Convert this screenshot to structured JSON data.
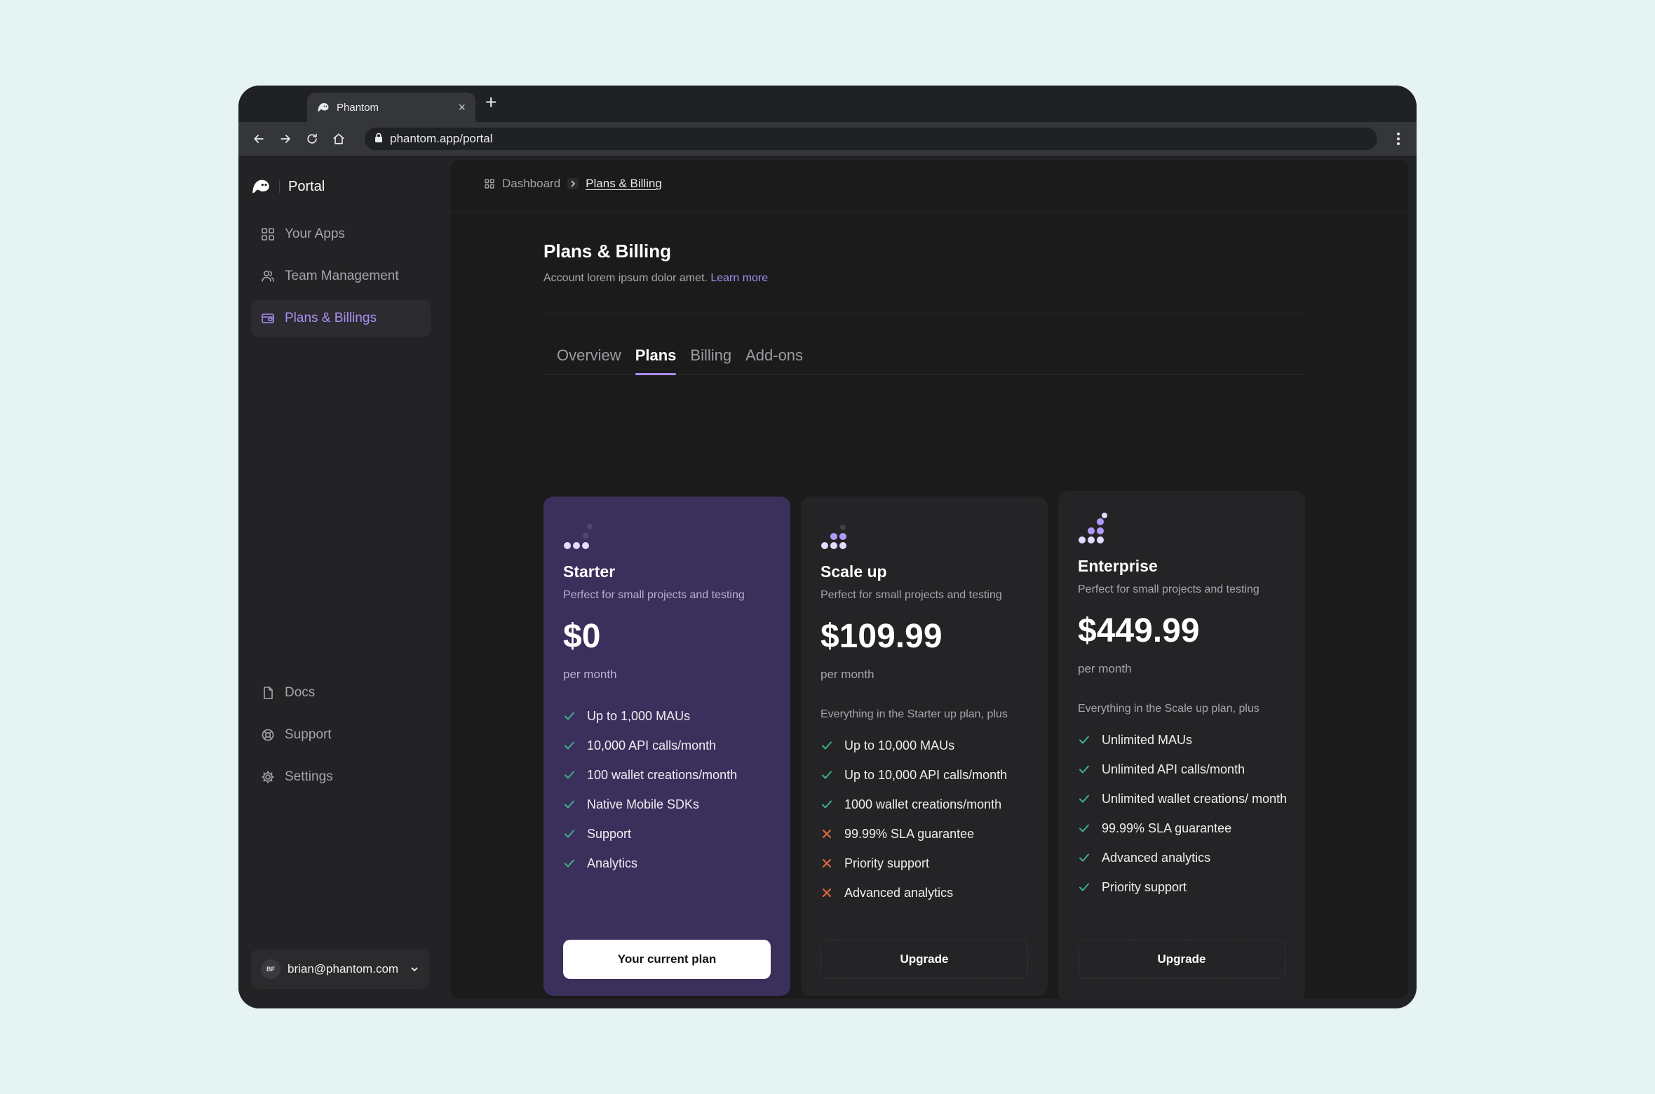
{
  "browser": {
    "tab_title": "Phantom",
    "tab_close": "×",
    "new_tab": "+",
    "url": "phantom.app/portal"
  },
  "sidebar": {
    "brand": "Portal",
    "items": [
      {
        "label": "Your Apps",
        "icon": "grid-icon"
      },
      {
        "label": "Team Management",
        "icon": "users-icon"
      },
      {
        "label": "Plans & Billings",
        "icon": "wallet-icon",
        "active": true
      }
    ],
    "bottom_items": [
      {
        "label": "Docs",
        "icon": "document-icon"
      },
      {
        "label": "Support",
        "icon": "lifebuoy-icon"
      },
      {
        "label": "Settings",
        "icon": "gear-icon"
      }
    ],
    "account": {
      "initials": "BF",
      "email": "brian@phantom.com"
    }
  },
  "breadcrumb": {
    "root": "Dashboard",
    "current": "Plans & Billing"
  },
  "page": {
    "title": "Plans & Billing",
    "subtitle": "Account lorem ipsum dolor amet.",
    "learn_more": "Learn more"
  },
  "tabs": [
    "Overview",
    "Plans",
    "Billing",
    "Add-ons"
  ],
  "active_tab": "Plans",
  "colors": {
    "accent": "#a88ff2",
    "current_plan_bg": "#3b2f5c",
    "check": "#3fb08c",
    "cross": "#e8683f"
  },
  "plans": [
    {
      "name": "Starter",
      "description": "Perfect for small projects and testing",
      "price": "$0",
      "period": "per month",
      "lead": "",
      "features": [
        {
          "text": "Up to 1,000 MAUs",
          "included": true
        },
        {
          "text": "10,000 API calls/month",
          "included": true
        },
        {
          "text": "100 wallet creations/month",
          "included": true
        },
        {
          "text": "Native Mobile SDKs",
          "included": true
        },
        {
          "text": "Support",
          "included": true
        },
        {
          "text": "Analytics",
          "included": true
        }
      ],
      "button": "Your current plan"
    },
    {
      "name": "Scale up",
      "description": "Perfect for small projects and testing",
      "price": "$109.99",
      "period": "per month",
      "lead": "Everything in the Starter up plan, plus",
      "features": [
        {
          "text": "Up to 10,000 MAUs",
          "included": true
        },
        {
          "text": "Up to 10,000 API calls/month",
          "included": true
        },
        {
          "text": "1000 wallet creations/month",
          "included": true
        },
        {
          "text": "99.99% SLA guarantee",
          "included": false
        },
        {
          "text": "Priority support",
          "included": false
        },
        {
          "text": "Advanced analytics",
          "included": false
        }
      ],
      "button": "Upgrade"
    },
    {
      "name": "Enterprise",
      "description": "Perfect for small projects and testing",
      "price": "$449.99",
      "period": "per month",
      "lead": "Everything in the Scale up plan, plus",
      "features": [
        {
          "text": "Unlimited MAUs",
          "included": true
        },
        {
          "text": "Unlimited API calls/month",
          "included": true
        },
        {
          "text": "Unlimited wallet creations/ month",
          "included": true
        },
        {
          "text": "99.99% SLA guarantee",
          "included": true
        },
        {
          "text": "Advanced analytics",
          "included": true
        },
        {
          "text": "Priority support",
          "included": true
        }
      ],
      "button": "Upgrade"
    }
  ]
}
